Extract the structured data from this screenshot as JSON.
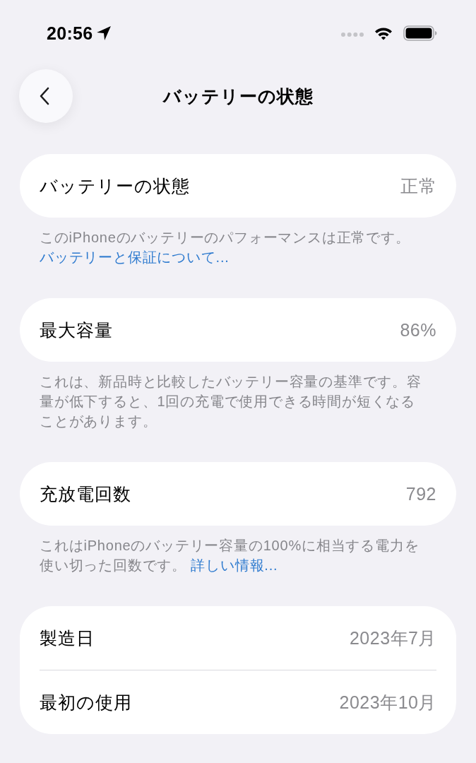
{
  "status_bar": {
    "time": "20:56"
  },
  "nav": {
    "title": "バッテリーの状態"
  },
  "sections": [
    {
      "rows": [
        {
          "label": "バッテリーの状態",
          "value": "正常"
        }
      ],
      "footer": {
        "text": "このiPhoneのバッテリーのパフォーマンスは正常です。",
        "link": "バッテリーと保証について..."
      }
    },
    {
      "rows": [
        {
          "label": "最大容量",
          "value": "86%"
        }
      ],
      "footer": {
        "text": "これは、新品時と比較したバッテリー容量の基準です。容量が低下すると、1回の充電で使用できる時間が短くなることがあります。"
      }
    },
    {
      "rows": [
        {
          "label": "充放電回数",
          "value": "792"
        }
      ],
      "footer": {
        "text": "これはiPhoneのバッテリー容量の100%に相当する電力を使い切った回数です。",
        "link": "詳しい情報..."
      }
    },
    {
      "rows": [
        {
          "label": "製造日",
          "value": "2023年7月"
        },
        {
          "label": "最初の使用",
          "value": "2023年10月"
        }
      ]
    }
  ]
}
